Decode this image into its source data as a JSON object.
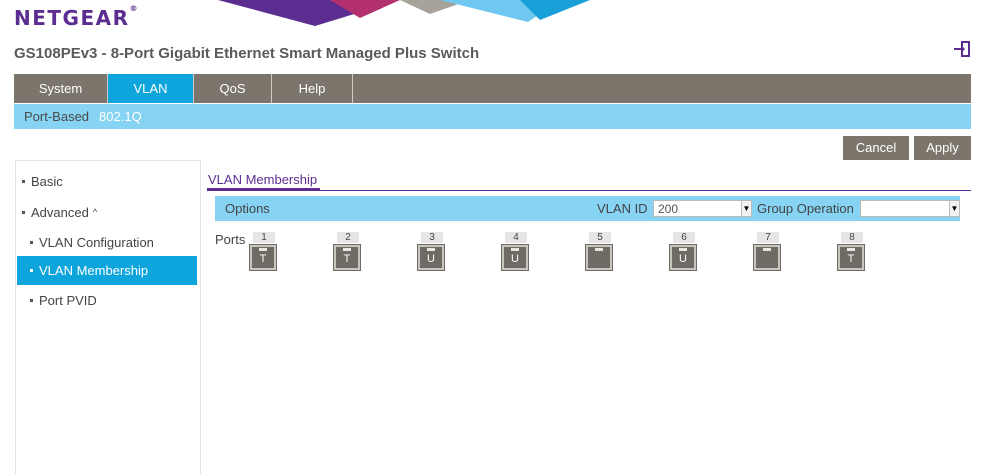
{
  "brand": {
    "name": "NETGEAR",
    "mark": "®"
  },
  "product_title": "GS108PEv3 - 8-Port Gigabit Ethernet Smart Managed Plus Switch",
  "icons": {
    "logout": "logout-icon"
  },
  "colors": {
    "brand_purple": "#5c2d91",
    "accent_blue": "#0ea5dc",
    "light_blue": "#86d3f3",
    "nav_gray": "#7b756c"
  },
  "topnav": {
    "tabs": [
      "System",
      "VLAN",
      "QoS",
      "Help"
    ],
    "active": "VLAN"
  },
  "subnav": {
    "tabs": [
      "Port-Based",
      "802.1Q"
    ],
    "active": "802.1Q"
  },
  "buttons": {
    "cancel": "Cancel",
    "apply": "Apply"
  },
  "sidebar": {
    "basic": "Basic",
    "advanced": "Advanced",
    "advanced_caret": "^",
    "items": [
      "VLAN Configuration",
      "VLAN Membership",
      "Port PVID"
    ],
    "active": "VLAN Membership"
  },
  "main": {
    "section_title": "VLAN Membership",
    "options_label": "Options",
    "vlan_id_label": "VLAN ID",
    "vlan_id_value": "200",
    "group_operation_label": "Group Operation",
    "group_operation_value": "",
    "ports_label": "Ports",
    "ports": [
      {
        "number": "1",
        "membership": "T"
      },
      {
        "number": "2",
        "membership": "T"
      },
      {
        "number": "3",
        "membership": "U"
      },
      {
        "number": "4",
        "membership": "U"
      },
      {
        "number": "5",
        "membership": ""
      },
      {
        "number": "6",
        "membership": "U"
      },
      {
        "number": "7",
        "membership": ""
      },
      {
        "number": "8",
        "membership": "T"
      }
    ]
  }
}
